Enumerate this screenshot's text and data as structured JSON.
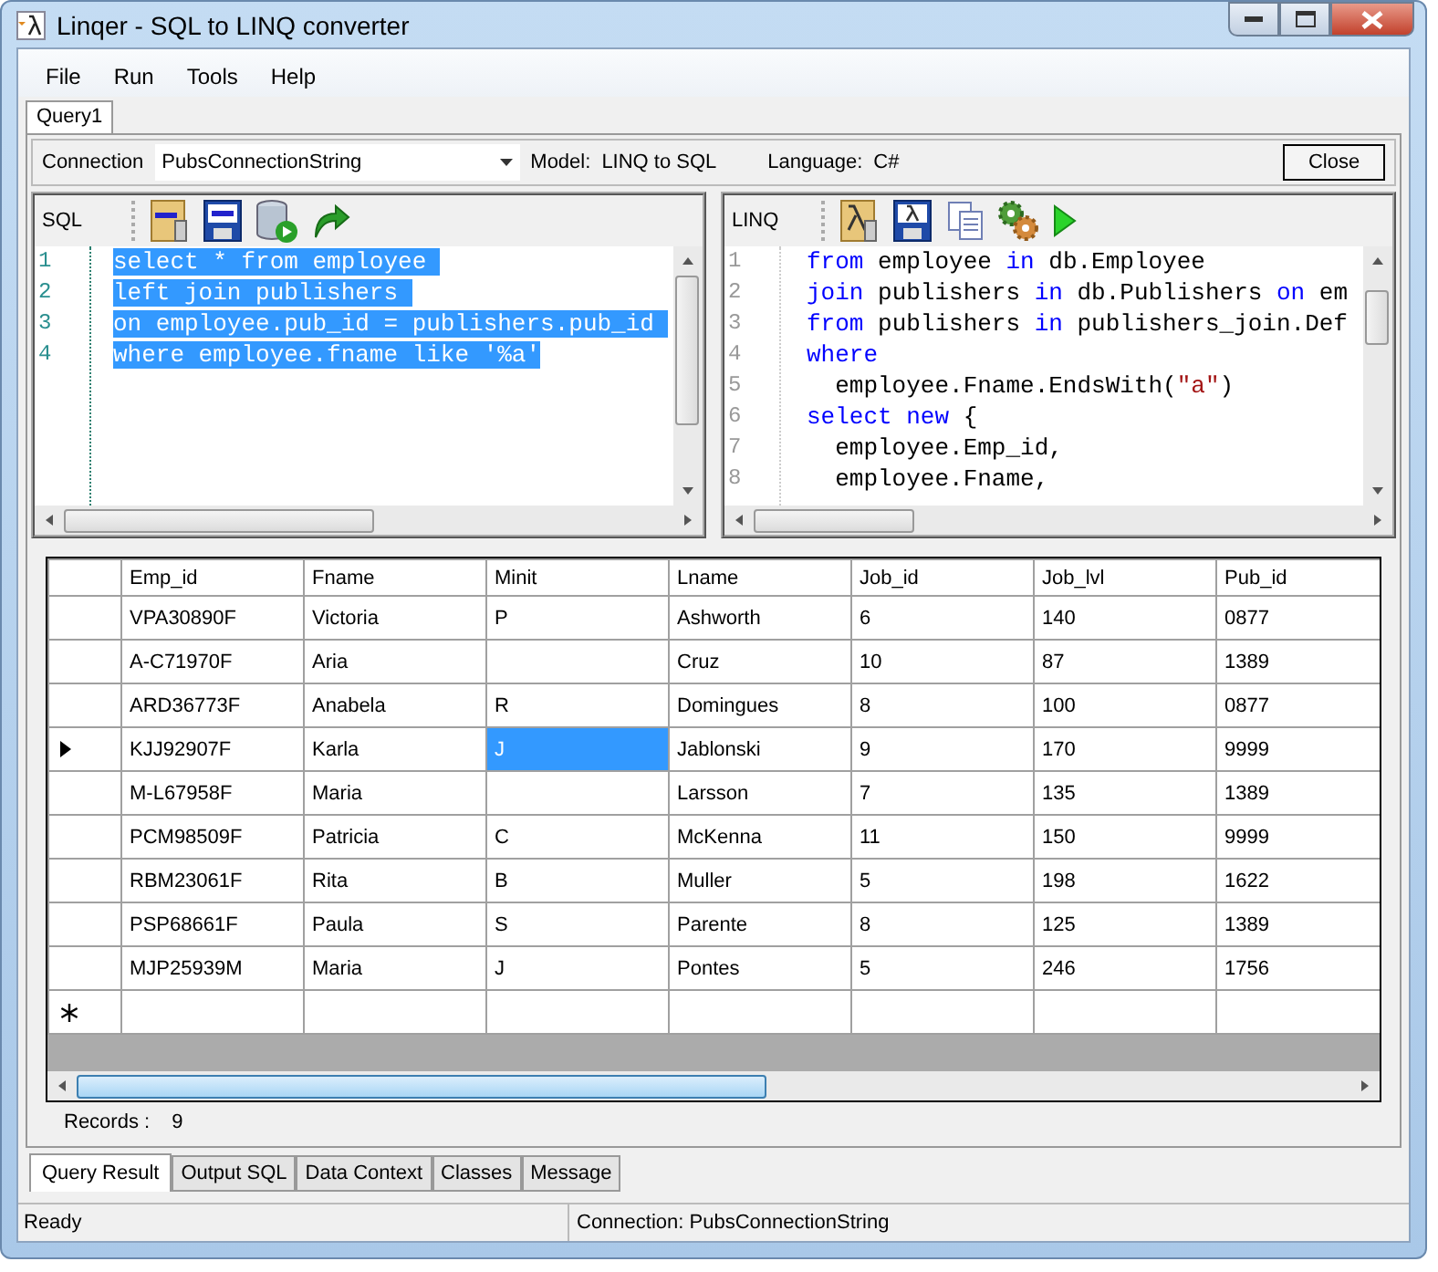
{
  "window": {
    "title": "Linqer - SQL to LINQ converter"
  },
  "menu": [
    {
      "label": "File"
    },
    {
      "label": "Run"
    },
    {
      "label": "Tools"
    },
    {
      "label": "Help"
    }
  ],
  "document_tabs": [
    {
      "label": "Query1",
      "selected": true
    }
  ],
  "connection": {
    "label": "Connection",
    "value": "PubsConnectionString",
    "model_label": "Model:",
    "model": "LINQ to SQL",
    "language_label": "Language:",
    "language": "C#",
    "close_button": "Close"
  },
  "sql_pane": {
    "label": "SQL",
    "lines": [
      {
        "number": "1",
        "text": "select * from employee ",
        "selected": true
      },
      {
        "number": "2",
        "text": "left join publishers ",
        "selected": true
      },
      {
        "number": "3",
        "text": "on employee.pub_id = publishers.pub_id ",
        "selected": true
      },
      {
        "number": "4",
        "text": "where employee.fname like '%a'",
        "selected": true
      }
    ]
  },
  "linq_pane": {
    "label": "LINQ",
    "lines": [
      {
        "number": "1",
        "tokens": [
          {
            "kind": "keyword",
            "text": "from"
          },
          {
            "kind": "plain",
            "text": " employee "
          },
          {
            "kind": "keyword",
            "text": "in"
          },
          {
            "kind": "plain",
            "text": " db.Employee"
          }
        ]
      },
      {
        "number": "2",
        "tokens": [
          {
            "kind": "keyword",
            "text": "join"
          },
          {
            "kind": "plain",
            "text": " publishers "
          },
          {
            "kind": "keyword",
            "text": "in"
          },
          {
            "kind": "plain",
            "text": " db.Publishers "
          },
          {
            "kind": "keyword",
            "text": "on"
          },
          {
            "kind": "plain",
            "text": " em"
          }
        ]
      },
      {
        "number": "3",
        "tokens": [
          {
            "kind": "keyword",
            "text": "from"
          },
          {
            "kind": "plain",
            "text": " publishers "
          },
          {
            "kind": "keyword",
            "text": "in"
          },
          {
            "kind": "plain",
            "text": " publishers_join.Def"
          }
        ]
      },
      {
        "number": "4",
        "tokens": [
          {
            "kind": "keyword",
            "text": "where"
          }
        ]
      },
      {
        "number": "5",
        "tokens": [
          {
            "kind": "plain",
            "text": "  employee.Fname.EndsWith("
          },
          {
            "kind": "string",
            "text": "\"a\""
          },
          {
            "kind": "plain",
            "text": ")"
          }
        ]
      },
      {
        "number": "6",
        "tokens": [
          {
            "kind": "keyword",
            "text": "select"
          },
          {
            "kind": "keyword",
            "text": " new"
          },
          {
            "kind": "plain",
            "text": " {"
          }
        ]
      },
      {
        "number": "7",
        "tokens": [
          {
            "kind": "plain",
            "text": "  employee.Emp_id,"
          }
        ]
      },
      {
        "number": "8",
        "tokens": [
          {
            "kind": "plain",
            "text": "  employee.Fname,"
          }
        ]
      }
    ]
  },
  "grid": {
    "columns": [
      "Emp_id",
      "Fname",
      "Minit",
      "Lname",
      "Job_id",
      "Job_lvl",
      "Pub_id"
    ],
    "rows": [
      {
        "current": false,
        "cells": [
          {
            "text": "VPA30890F",
            "selected": false
          },
          {
            "text": "Victoria",
            "selected": false
          },
          {
            "text": "P",
            "selected": false
          },
          {
            "text": "Ashworth",
            "selected": false
          },
          {
            "text": "6",
            "selected": false
          },
          {
            "text": "140",
            "selected": false
          },
          {
            "text": "0877",
            "selected": false
          }
        ]
      },
      {
        "current": false,
        "cells": [
          {
            "text": "A-C71970F",
            "selected": false
          },
          {
            "text": "Aria",
            "selected": false
          },
          {
            "selected": false
          },
          {
            "text": "Cruz",
            "selected": false
          },
          {
            "text": "10",
            "selected": false
          },
          {
            "text": "87",
            "selected": false
          },
          {
            "text": "1389",
            "selected": false
          }
        ]
      },
      {
        "current": false,
        "cells": [
          {
            "text": "ARD36773F",
            "selected": false
          },
          {
            "text": "Anabela",
            "selected": false
          },
          {
            "text": "R",
            "selected": false
          },
          {
            "text": "Domingues",
            "selected": false
          },
          {
            "text": "8",
            "selected": false
          },
          {
            "text": "100",
            "selected": false
          },
          {
            "text": "0877",
            "selected": false
          }
        ]
      },
      {
        "current": true,
        "cells": [
          {
            "text": "KJJ92907F",
            "selected": false
          },
          {
            "text": "Karla",
            "selected": false
          },
          {
            "text": "J",
            "selected": true
          },
          {
            "text": "Jablonski",
            "selected": false
          },
          {
            "text": "9",
            "selected": false
          },
          {
            "text": "170",
            "selected": false
          },
          {
            "text": "9999",
            "selected": false
          }
        ]
      },
      {
        "current": false,
        "cells": [
          {
            "text": "M-L67958F",
            "selected": false
          },
          {
            "text": "Maria",
            "selected": false
          },
          {
            "selected": false
          },
          {
            "text": "Larsson",
            "selected": false
          },
          {
            "text": "7",
            "selected": false
          },
          {
            "text": "135",
            "selected": false
          },
          {
            "text": "1389",
            "selected": false
          }
        ]
      },
      {
        "current": false,
        "cells": [
          {
            "text": "PCM98509F",
            "selected": false
          },
          {
            "text": "Patricia",
            "selected": false
          },
          {
            "text": "C",
            "selected": false
          },
          {
            "text": "McKenna",
            "selected": false
          },
          {
            "text": "11",
            "selected": false
          },
          {
            "text": "150",
            "selected": false
          },
          {
            "text": "9999",
            "selected": false
          }
        ]
      },
      {
        "current": false,
        "cells": [
          {
            "text": "RBM23061F",
            "selected": false
          },
          {
            "text": "Rita",
            "selected": false
          },
          {
            "text": "B",
            "selected": false
          },
          {
            "text": "Muller",
            "selected": false
          },
          {
            "text": "5",
            "selected": false
          },
          {
            "text": "198",
            "selected": false
          },
          {
            "text": "1622",
            "selected": false
          }
        ]
      },
      {
        "current": false,
        "cells": [
          {
            "text": "PSP68661F",
            "selected": false
          },
          {
            "text": "Paula",
            "selected": false
          },
          {
            "text": "S",
            "selected": false
          },
          {
            "text": "Parente",
            "selected": false
          },
          {
            "text": "8",
            "selected": false
          },
          {
            "text": "125",
            "selected": false
          },
          {
            "text": "1389",
            "selected": false
          }
        ]
      },
      {
        "current": false,
        "cells": [
          {
            "text": "MJP25939M",
            "selected": false
          },
          {
            "text": "Maria",
            "selected": false
          },
          {
            "text": "J",
            "selected": false
          },
          {
            "text": "Pontes",
            "selected": false
          },
          {
            "text": "5",
            "selected": false
          },
          {
            "text": "246",
            "selected": false
          },
          {
            "text": "1756",
            "selected": false
          }
        ]
      }
    ]
  },
  "records": {
    "label": "Records :",
    "value": "9"
  },
  "result_tabs": [
    {
      "label": "Query Result",
      "selected": true
    },
    {
      "label": "Output SQL",
      "selected": false
    },
    {
      "label": "Data Context",
      "selected": false
    },
    {
      "label": "Classes",
      "selected": false
    },
    {
      "label": "Message",
      "selected": false
    }
  ],
  "status_bar": {
    "state": "Ready",
    "connection": "Connection: PubsConnectionString"
  }
}
